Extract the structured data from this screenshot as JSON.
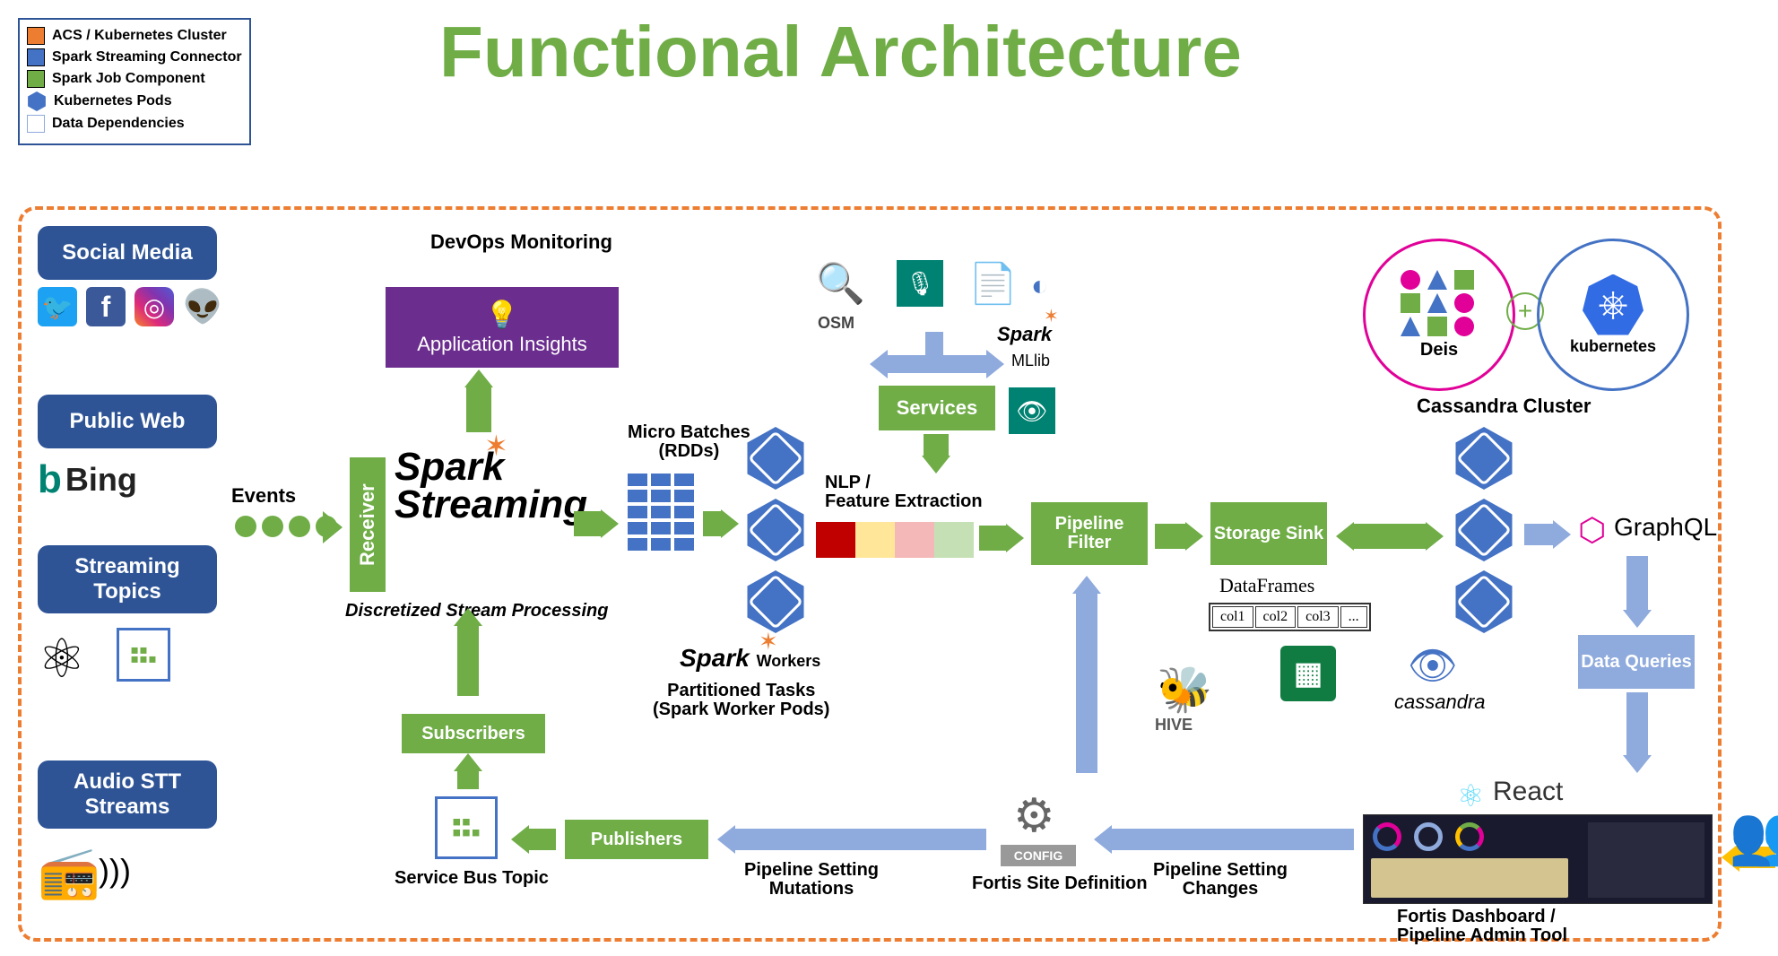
{
  "title": "Functional Architecture",
  "legend": {
    "acs": "ACS / Kubernetes Cluster",
    "connector": "Spark Streaming Connector",
    "job": "Spark Job Component",
    "pods": "Kubernetes Pods",
    "deps": "Data Dependencies"
  },
  "sources": {
    "social": "Social Media",
    "public": "Public Web",
    "streaming": "Streaming Topics",
    "audio": "Audio STT Streams",
    "bing": "Bing"
  },
  "labels": {
    "events": "Events",
    "receiver": "Receiver",
    "spark_streaming_1": "Spark",
    "spark_streaming_2": "Streaming",
    "dsp": "Discretized Stream Processing",
    "devops": "DevOps Monitoring",
    "app_insights": "Application Insights",
    "micro_1": "Micro Batches",
    "micro_2": "(RDDs)",
    "spark_workers": "Spark",
    "workers": "Workers",
    "partitioned_1": "Partitioned Tasks",
    "partitioned_2": "(Spark Worker Pods)",
    "services": "Services",
    "osm": "OSM",
    "spark_mllib": "Spark",
    "mllib": "MLlib",
    "nlp_1": "NLP /",
    "nlp_2": "Feature Extraction",
    "pipeline_filter": "Pipeline Filter",
    "storage_sink": "Storage Sink",
    "dataframes": "DataFrames",
    "df_c1": "col1",
    "df_c2": "col2",
    "df_c3": "col3",
    "df_more": "...",
    "hive": "HIVE",
    "cassandra_cluster": "Cassandra Cluster",
    "cassandra": "cassandra",
    "graphql": "GraphQL",
    "data_queries": "Data Queries",
    "react": "React",
    "fortis_dash_1": "Fortis Dashboard /",
    "fortis_dash_2": "Pipeline Admin Tool",
    "deis": "Deis",
    "kubernetes": "kubernetes",
    "subscribers": "Subscribers",
    "publishers": "Publishers",
    "service_bus_topic": "Service Bus Topic",
    "config": "CONFIG",
    "fortis_site": "Fortis Site Definition",
    "psm_1": "Pipeline Setting",
    "psm_2": "Mutations",
    "psc_1": "Pipeline Setting",
    "psc_2": "Changes",
    "plus": "+"
  }
}
